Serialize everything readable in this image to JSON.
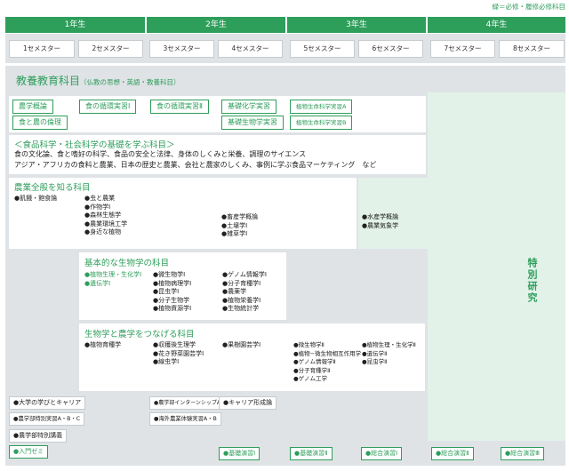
{
  "legend": "緑＝必修・履修必修科目",
  "years": [
    "1年生",
    "2年生",
    "3年生",
    "4年生"
  ],
  "semesters": [
    "1セメスター",
    "2セメスター",
    "3セメスター",
    "4セメスター",
    "5セメスター",
    "6セメスター",
    "7セメスター",
    "8セメスター"
  ],
  "liberal_arts": {
    "title": "教養教育科目",
    "subtitle": "（仏教の思想・英語・教養科目）"
  },
  "top_chips": {
    "c1": "農学概論",
    "c2": "食と農の倫理",
    "c3": "食の循環実習Ⅰ",
    "c4": "食の循環実習Ⅱ",
    "c5": "基礎化学実習",
    "c6": "基礎生物学実習",
    "c7": "植物生命科学実習A",
    "c8": "植物生命科学実習B"
  },
  "food_science": {
    "title": "＜食品科学・社会科学の基礎を学ぶ科目＞",
    "line1": "食の文化論、食と嗜好の科学、食品の安全と法律、身体のしくみと栄養、調理のサイエンス",
    "line2": "アジア・アフリカの食料と農業、日本の歴史と農業、会社と農家のしくみ、事例に学ぶ食品マーケティング　など"
  },
  "agri_general": {
    "title": "農業全般を知る科目",
    "col1": [
      "●飢餓・飽食論"
    ],
    "col2": [
      "●虫と農業",
      "●作物学Ⅰ",
      "●森林生態学",
      "●農業環境工学",
      "●身近な植物"
    ],
    "col4": [
      "●畜産学概論",
      "●土壌学Ⅰ",
      "●雑草学Ⅰ"
    ],
    "col6": [
      "●水産学概論",
      "●農業気象学"
    ]
  },
  "bio_basic": {
    "title": "基本的な生物学の科目",
    "col2": [
      "●植物生理・生化学Ⅰ",
      "●遺伝学Ⅰ"
    ],
    "col3": [
      "●微生物学Ⅰ",
      "●植物病理学Ⅰ",
      "●昆虫学Ⅰ",
      "●分子生物学",
      "●植物資源学Ⅰ"
    ],
    "col4": [
      "●ゲノム情報学Ⅰ",
      "●分子育種学Ⅰ",
      "●農薬学",
      "●植物栄養学Ⅰ",
      "●生物統計学"
    ]
  },
  "bio_agri": {
    "title": "生物学と農学をつなげる科目",
    "col2": [
      "●植物育種学"
    ],
    "col3": [
      "●収穫後生理学",
      "●花き野菜園芸学Ⅰ",
      "●線虫学Ⅰ"
    ],
    "col4": [
      "●果樹園芸学Ⅰ"
    ],
    "col5": [
      "●微生物学Ⅱ",
      "●植物−微生物相互作用学",
      "●ゲノム情報学Ⅱ",
      "●分子育種学Ⅱ",
      "●ゲノム工学"
    ],
    "col6": [
      "●植物生理・生化学Ⅱ",
      "●遺伝学Ⅱ",
      "●昆虫学Ⅱ"
    ]
  },
  "special_research": "特別研究",
  "bottom": {
    "b1": "●大学の学びとキャリア",
    "b2": "●農学部特別実習A・B・C",
    "b3": "●農学部特別講義",
    "b4": "●入門ゼミ",
    "b5": "●農学部インターンシップA・B",
    "b6": "●海外農業体験実習A・B",
    "b7": "●キャリア形成論",
    "b8": "●基礎演習Ⅰ",
    "b9": "●基礎演習Ⅱ",
    "b10": "●総合演習Ⅰ",
    "b11": "●総合演習Ⅱ",
    "b12": "●総合演習Ⅲ"
  }
}
